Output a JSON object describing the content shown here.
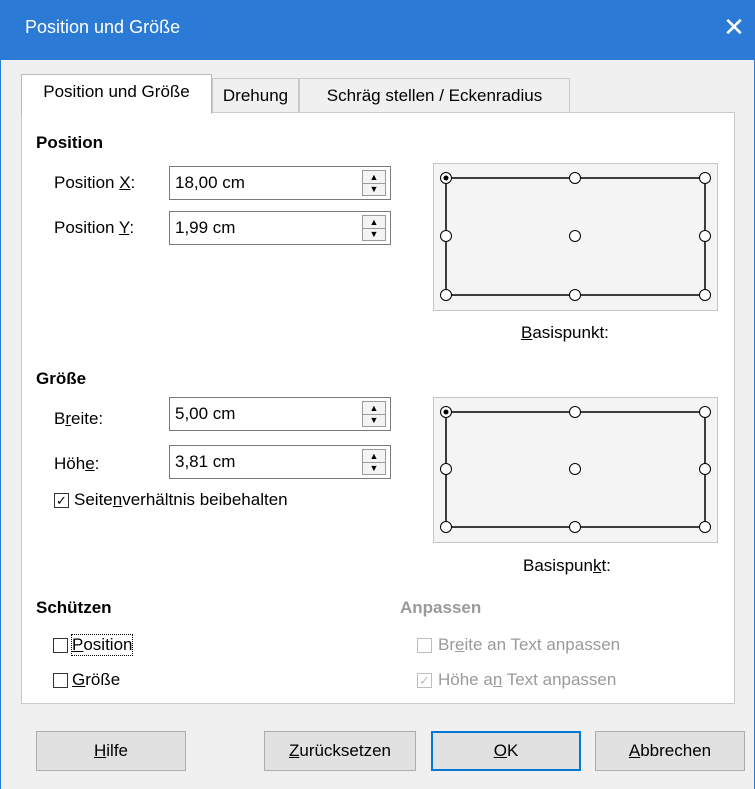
{
  "dialog": {
    "title": "Position und Größe",
    "close_glyph": "✕"
  },
  "tabs": [
    {
      "label": "Position und Größe",
      "active": true
    },
    {
      "label": "Drehung",
      "active": false
    },
    {
      "label": "Schräg stellen / Eckenradius",
      "active": false
    }
  ],
  "position": {
    "heading": "Position",
    "x_label_pre": "Position ",
    "x_label_key": "X",
    "x_label_post": ":",
    "x_value": "18,00 cm",
    "y_label_pre": "Position ",
    "y_label_key": "Y",
    "y_label_post": ":",
    "y_value": "1,99 cm",
    "basis_pre": "",
    "basis_key": "B",
    "basis_post": "asispunkt:"
  },
  "size": {
    "heading": "Größe",
    "width_pre": "B",
    "width_key": "r",
    "width_post": "eite:",
    "width_value": "5,00 cm",
    "height_pre": "Höh",
    "height_key": "e",
    "height_post": ":",
    "height_value": "3,81 cm",
    "keep_ratio_pre": "Seite",
    "keep_ratio_key": "n",
    "keep_ratio_post": "verhältnis beibehalten",
    "keep_ratio_checked": true,
    "basis_pre": "Basispun",
    "basis_key": "k",
    "basis_post": "t:"
  },
  "protect": {
    "heading": "Schützen",
    "position_key": "P",
    "position_post": "osition",
    "position_checked": false,
    "size_key": "G",
    "size_post": "röße",
    "size_checked": false
  },
  "adjust": {
    "heading": "Anpassen",
    "width_pre": "Br",
    "width_key": "e",
    "width_post": "ite an Text anpassen",
    "width_checked": false,
    "height_pre": "Höhe a",
    "height_key": "n",
    "height_post": " Text anpassen",
    "height_checked": true
  },
  "buttons": {
    "help_key": "H",
    "help_post": "ilfe",
    "reset_key": "Z",
    "reset_post": "urücksetzen",
    "ok_key": "O",
    "ok_post": "K",
    "cancel_key": "A",
    "cancel_post": "bbrechen"
  },
  "colors": {
    "titlebar": "#2b7bd6",
    "default_button_border": "#0078d7"
  },
  "icons": {
    "spin_up": "▲",
    "spin_down": "▼",
    "check": "✓"
  }
}
